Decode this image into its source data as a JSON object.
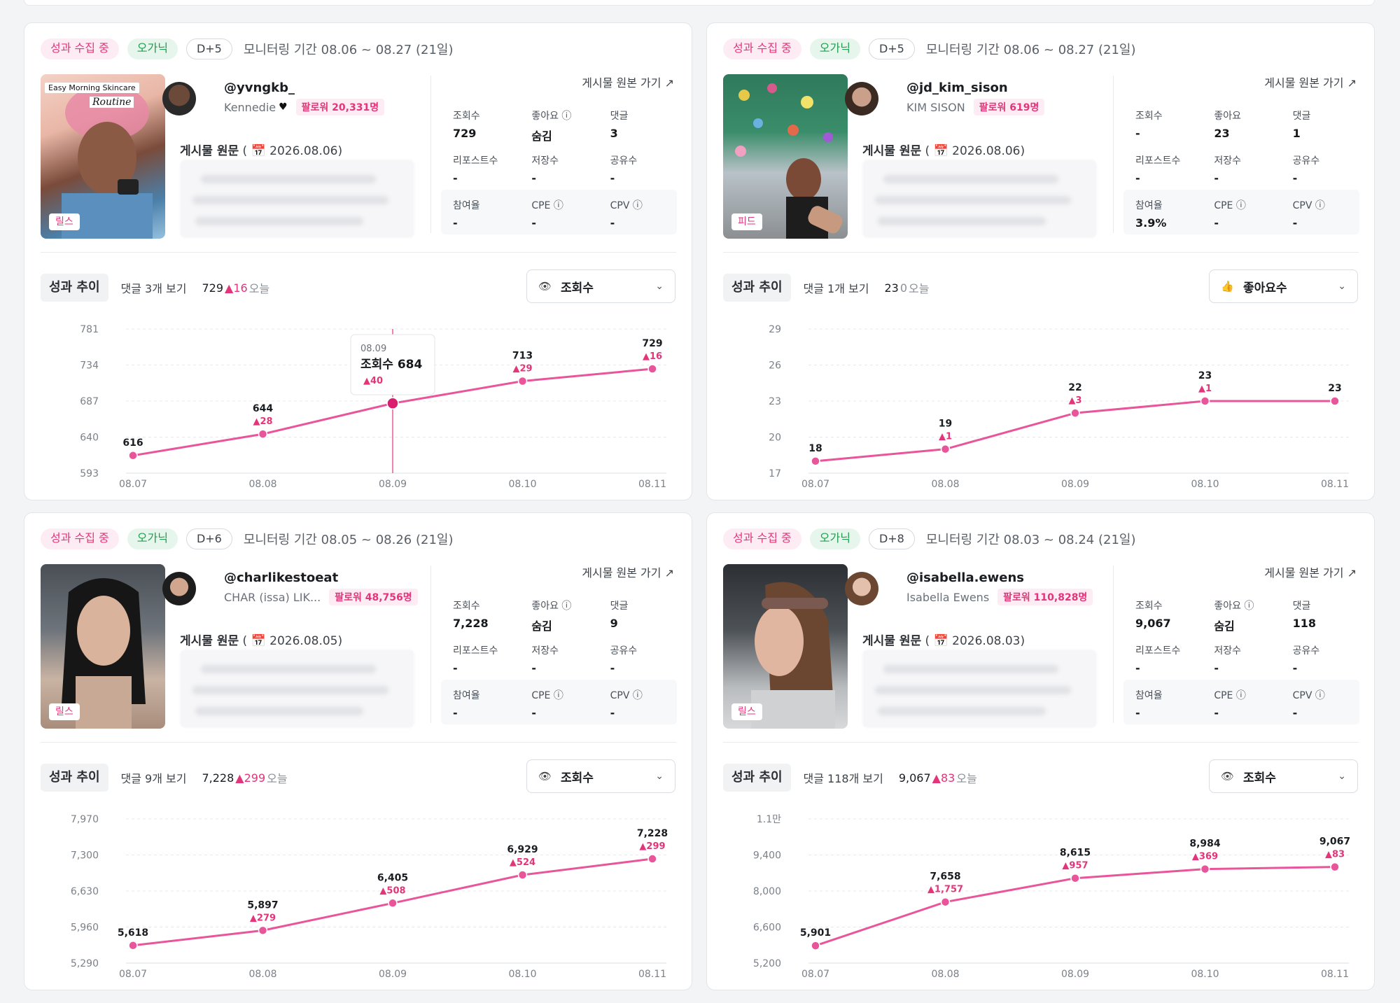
{
  "cards": [
    {
      "status": "성과 수집 중",
      "type": "오가닉",
      "dday": "D+5",
      "period": "모니터링 기간 08.06 ~ 08.27 (21일)",
      "media_tag": "릴스",
      "thumb_caption": "Easy Morning Skincare",
      "thumb_caption2": "Routine",
      "handle": "@yvngkb_",
      "display_name": "Kennedie",
      "followers": "팔로워 20,331명",
      "post_label": "게시물 원문",
      "post_date": "2026.08.06",
      "orig_link": "게시물 원본 가기",
      "stats": [
        [
          "조회수",
          "729"
        ],
        [
          "좋아요",
          "숨김"
        ],
        [
          "댓글",
          "3"
        ],
        [
          "리포스트수",
          "-"
        ],
        [
          "저장수",
          "-"
        ],
        [
          "공유수",
          "-"
        ],
        [
          "참여율",
          "-"
        ],
        [
          "CPE",
          "-"
        ],
        [
          "CPV",
          "-"
        ]
      ],
      "trend_label": "성과 추이",
      "comments_link": "댓글 3개 보기",
      "today_value": "729",
      "today_inc": "▲16",
      "today_label": "오늘",
      "metric": "조회수",
      "metric_icon": "eye-icon"
    },
    {
      "status": "성과 수집 중",
      "type": "오가닉",
      "dday": "D+5",
      "period": "모니터링 기간 08.06 ~ 08.27 (21일)",
      "media_tag": "피드",
      "handle": "@jd_kim_sison",
      "display_name": "KIM SISON",
      "followers": "팔로워 619명",
      "post_label": "게시물 원문",
      "post_date": "2026.08.06",
      "orig_link": "게시물 원본 가기",
      "stats": [
        [
          "조회수",
          "-"
        ],
        [
          "좋아요",
          "23"
        ],
        [
          "댓글",
          "1"
        ],
        [
          "리포스트수",
          "-"
        ],
        [
          "저장수",
          "-"
        ],
        [
          "공유수",
          "-"
        ],
        [
          "참여율",
          "3.9%"
        ],
        [
          "CPE",
          "-"
        ],
        [
          "CPV",
          "-"
        ]
      ],
      "trend_label": "성과 추이",
      "comments_link": "댓글 1개 보기",
      "today_value": "23",
      "today_inc": "0",
      "today_label": "오늘",
      "metric": "좋아요수",
      "metric_icon": "thumbs-up-icon"
    },
    {
      "status": "성과 수집 중",
      "type": "오가닉",
      "dday": "D+6",
      "period": "모니터링 기간 08.05 ~ 08.26 (21일)",
      "media_tag": "릴스",
      "handle": "@charlikestoeat",
      "display_name": "CHAR (issa) LIK...",
      "followers": "팔로워 48,756명",
      "post_label": "게시물 원문",
      "post_date": "2026.08.05",
      "orig_link": "게시물 원본 가기",
      "stats": [
        [
          "조회수",
          "7,228"
        ],
        [
          "좋아요",
          "숨김"
        ],
        [
          "댓글",
          "9"
        ],
        [
          "리포스트수",
          "-"
        ],
        [
          "저장수",
          "-"
        ],
        [
          "공유수",
          "-"
        ],
        [
          "참여율",
          "-"
        ],
        [
          "CPE",
          "-"
        ],
        [
          "CPV",
          "-"
        ]
      ],
      "trend_label": "성과 추이",
      "comments_link": "댓글 9개 보기",
      "today_value": "7,228",
      "today_inc": "▲299",
      "today_label": "오늘",
      "metric": "조회수",
      "metric_icon": "eye-icon"
    },
    {
      "status": "성과 수집 중",
      "type": "오가닉",
      "dday": "D+8",
      "period": "모니터링 기간 08.03 ~ 08.24 (21일)",
      "media_tag": "릴스",
      "handle": "@isabella.ewens",
      "display_name": "Isabella Ewens",
      "followers": "팔로워 110,828명",
      "post_label": "게시물 원문",
      "post_date": "2026.08.03",
      "orig_link": "게시물 원본 가기",
      "stats": [
        [
          "조회수",
          "9,067"
        ],
        [
          "좋아요",
          "숨김"
        ],
        [
          "댓글",
          "118"
        ],
        [
          "리포스트수",
          "-"
        ],
        [
          "저장수",
          "-"
        ],
        [
          "공유수",
          "-"
        ],
        [
          "참여율",
          "-"
        ],
        [
          "CPE",
          "-"
        ],
        [
          "CPV",
          "-"
        ]
      ],
      "trend_label": "성과 추이",
      "comments_link": "댓글 118개 보기",
      "today_value": "9,067",
      "today_inc": "▲83",
      "today_label": "오늘",
      "metric": "조회수",
      "metric_icon": "eye-icon"
    }
  ],
  "colors": {
    "accent": "#e2357a",
    "line": "#e8559a",
    "badge_green": "#1f9d4f"
  },
  "chart_data": [
    {
      "type": "line",
      "x": [
        "08.07",
        "08.08",
        "08.09",
        "08.10",
        "08.11"
      ],
      "ylim": [
        593,
        781
      ],
      "yticks": [
        "781",
        "734",
        "687",
        "640",
        "593"
      ],
      "series": [
        {
          "values": [
            616,
            644,
            684,
            713,
            729
          ]
        }
      ],
      "value_labels": [
        "616",
        "644",
        "684",
        "713",
        "729"
      ],
      "increments": [
        "",
        "▲28",
        "▲40",
        "▲29",
        "▲16"
      ],
      "tooltip": {
        "index": 2,
        "date": "08.09",
        "label": "조회수 684",
        "inc": "▲40"
      }
    },
    {
      "type": "line",
      "x": [
        "08.07",
        "08.08",
        "08.09",
        "08.10",
        "08.11"
      ],
      "ylim": [
        17,
        29
      ],
      "yticks": [
        "29",
        "26",
        "23",
        "20",
        "17"
      ],
      "series": [
        {
          "values": [
            18,
            19,
            22,
            23,
            23
          ]
        }
      ],
      "value_labels": [
        "18",
        "19",
        "22",
        "23",
        "23"
      ],
      "increments": [
        "",
        "▲1",
        "▲3",
        "▲1",
        ""
      ]
    },
    {
      "type": "line",
      "x": [
        "08.07",
        "08.08",
        "08.09",
        "08.10",
        "08.11"
      ],
      "ylim": [
        5290,
        7970
      ],
      "yticks": [
        "7,970",
        "7,300",
        "6,630",
        "5,960",
        "5,290"
      ],
      "series": [
        {
          "values": [
            5618,
            5897,
            6405,
            6929,
            7228
          ]
        }
      ],
      "value_labels": [
        "5,618",
        "5,897",
        "6,405",
        "6,929",
        "7,228"
      ],
      "increments": [
        "",
        "▲279",
        "▲508",
        "▲524",
        "▲299"
      ]
    },
    {
      "type": "line",
      "x": [
        "08.07",
        "08.08",
        "08.09",
        "08.10",
        "08.11"
      ],
      "ylim": [
        5200,
        11000
      ],
      "yticks": [
        "1.1만",
        "9,400",
        "8,000",
        "6,600",
        "5,200"
      ],
      "series": [
        {
          "values": [
            5901,
            7658,
            8615,
            8984,
            9067
          ]
        }
      ],
      "value_labels": [
        "5,901",
        "7,658",
        "8,615",
        "8,984",
        "9,067"
      ],
      "increments": [
        "",
        "▲1,757",
        "▲957",
        "▲369",
        "▲83"
      ]
    }
  ]
}
